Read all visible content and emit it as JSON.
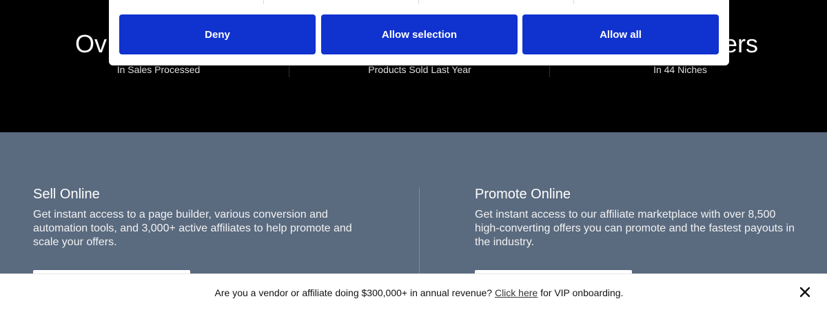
{
  "stats": {
    "heading_left": "Ov",
    "heading_right": "ers",
    "items": [
      {
        "caption": "In Sales Processed"
      },
      {
        "caption": "Products Sold Last Year"
      },
      {
        "caption": "In 44 Niches"
      }
    ]
  },
  "consent": {
    "deny_label": "Deny",
    "selection_label": "Allow selection",
    "all_label": "Allow all",
    "accent_color": "#1032cf"
  },
  "offers": {
    "background_color": "#5a6a7f",
    "sell": {
      "title": "Sell Online",
      "description": "Get instant access to a page builder, various conversion and automation tools, and 3,000+ active affiliates to help promote and scale your offers."
    },
    "promote": {
      "title": "Promote Online",
      "description": "Get instant access to our affiliate marketplace with over 8,500 high-converting offers you can promote and the fastest payouts in the industry."
    }
  },
  "vip_bar": {
    "text_before": "Are you a vendor or affiliate doing $300,000+ in annual revenue? ",
    "link_text": "Click here",
    "text_after": " for VIP onboarding.",
    "close_icon": "close-icon"
  }
}
